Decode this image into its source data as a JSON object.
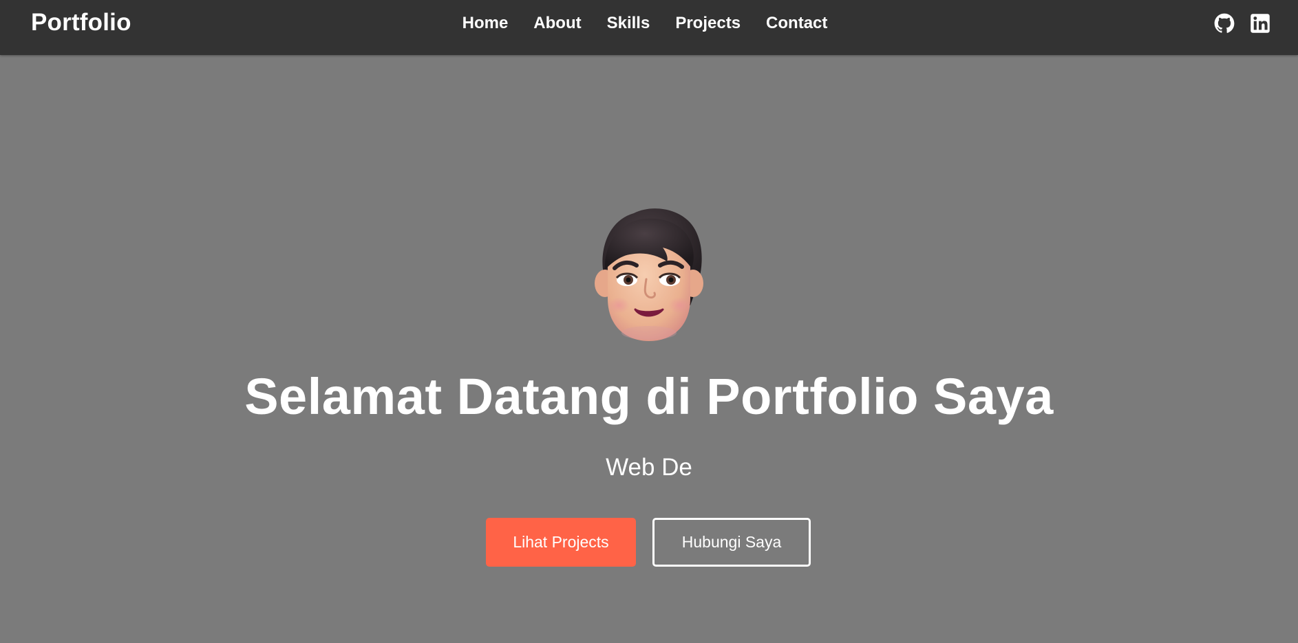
{
  "navbar": {
    "logo": "Portfolio",
    "links": [
      {
        "label": "Home"
      },
      {
        "label": "About"
      },
      {
        "label": "Skills"
      },
      {
        "label": "Projects"
      },
      {
        "label": "Contact"
      }
    ],
    "socials": [
      {
        "icon": "github-icon"
      },
      {
        "icon": "linkedin-icon"
      }
    ]
  },
  "hero": {
    "avatar_icon": "avatar-emoji",
    "title": "Selamat Datang di Portfolio Saya",
    "subtitle": "Web De",
    "primary_button": "Lihat Projects",
    "secondary_button": "Hubungi Saya"
  },
  "colors": {
    "navbar_bg": "#333333",
    "hero_bg": "#7b7b7b",
    "accent": "#ff6347",
    "text": "#ffffff"
  }
}
